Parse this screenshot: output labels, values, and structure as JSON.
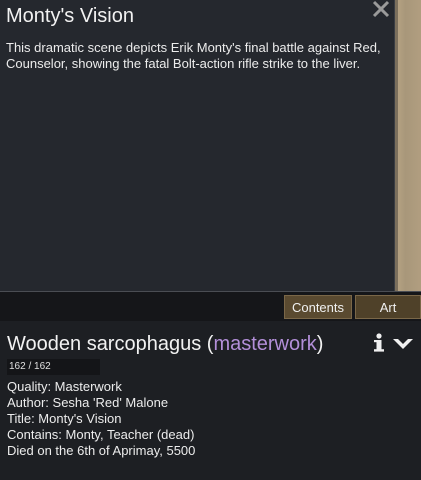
{
  "art_dialog": {
    "title": "Monty's Vision",
    "description": "This dramatic scene depicts Erik Monty's final battle against Red, Counselor, showing the fatal Bolt-action rifle strike to the liver.",
    "close_icon": "close-icon"
  },
  "tabs": [
    {
      "label": "Contents"
    },
    {
      "label": "Art"
    }
  ],
  "inspect": {
    "name": "Wooden sarcophagus",
    "open_paren": " (",
    "quality": "masterwork",
    "close_paren": ")",
    "quality_color": "#b38fd9",
    "hp": {
      "text": "162 / 162",
      "fraction": 1.0
    },
    "details": [
      "Quality: Masterwork",
      "Author: Sesha 'Red' Malone",
      "Title: Monty's Vision",
      "Contains: Monty, Teacher (dead)",
      "Died on the 6th of Aprimay, 5500"
    ],
    "icons": {
      "info": "info-icon",
      "collapse": "collapse-icon"
    }
  }
}
